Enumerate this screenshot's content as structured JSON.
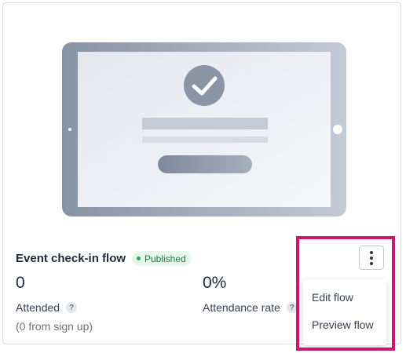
{
  "card": {
    "illustration_icon": "tablet-checkmark-illustration",
    "title": "Event check-in flow",
    "status": "Published",
    "stats": [
      {
        "value": "0",
        "label": "Attended",
        "help": "?"
      },
      {
        "value": "0%",
        "label": "Attendance rate",
        "help": "?"
      }
    ],
    "sub_note": "(0 from sign up)"
  },
  "menu": {
    "trigger_icon": "kebab-menu-icon",
    "items": [
      {
        "label": "Edit flow"
      },
      {
        "label": "Preview flow"
      }
    ]
  },
  "colors": {
    "badge_bg": "#e7f6ec",
    "badge_text": "#1f7a3d",
    "highlight": "#c8176d"
  }
}
